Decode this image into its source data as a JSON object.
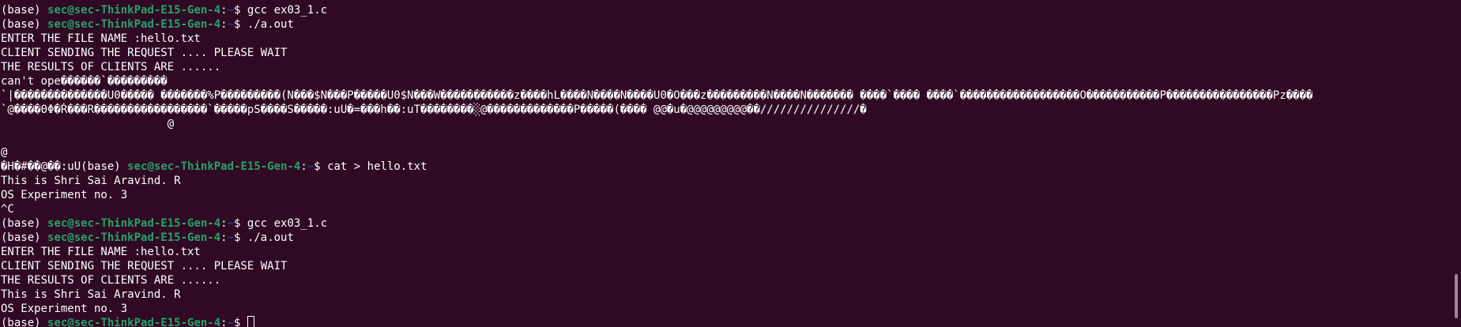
{
  "terminal": {
    "colors": {
      "background": "#300a24",
      "text": "#ffffff",
      "prompt_user": "#26a269",
      "prompt_path": "#12488b"
    },
    "prompt": {
      "env": "(base) ",
      "user_host": "sec@sec-ThinkPad-E15-Gen-4",
      "sep": ":",
      "path": "~",
      "dollar": "$ "
    },
    "lines": [
      {
        "type": "prompt",
        "command": "gcc ex03_1.c"
      },
      {
        "type": "prompt",
        "command": "./a.out"
      },
      {
        "type": "text",
        "text": "ENTER THE FILE NAME :hello.txt"
      },
      {
        "type": "text",
        "text": "CLIENT SENDING THE REQUEST .... PLEASE WAIT"
      },
      {
        "type": "text",
        "text": "THE RESULTS OF CLIENTS ARE ......"
      },
      {
        "type": "text",
        "text": "can't ope������`���������"
      },
      {
        "type": "text",
        "text": "`|��������������U0����� �������%P���������(N���$N���P�����U0$N���W�����������z����hL����N����N����U0�O���z���������N����N������� ����`���� ����`������������������O�����������P����������������Pz����"
      },
      {
        "type": "text",
        "text": "`@����ΘΦ�Ŕ���R�����������������`�����pS����S�����:uU�=���h��:uT��������░@�������������P�����(���� @@�u�@@@@@@@@@��///////////////�"
      },
      {
        "type": "text",
        "text": "                         @"
      },
      {
        "type": "text",
        "text": ""
      },
      {
        "type": "text",
        "text": "@"
      },
      {
        "type": "mixed",
        "prefix": "�H�#��@��:uU",
        "command": "cat > hello.txt"
      },
      {
        "type": "text",
        "text": "This is Shri Sai Aravind. R"
      },
      {
        "type": "text",
        "text": "OS Experiment no. 3"
      },
      {
        "type": "text",
        "text": "^C"
      },
      {
        "type": "prompt",
        "command": "gcc ex03_1.c"
      },
      {
        "type": "prompt",
        "command": "./a.out"
      },
      {
        "type": "text",
        "text": "ENTER THE FILE NAME :hello.txt"
      },
      {
        "type": "text",
        "text": "CLIENT SENDING THE REQUEST .... PLEASE WAIT"
      },
      {
        "type": "text",
        "text": "THE RESULTS OF CLIENTS ARE ......"
      },
      {
        "type": "text",
        "text": "This is Shri Sai Aravind. R"
      },
      {
        "type": "text",
        "text": "OS Experiment no. 3"
      },
      {
        "type": "prompt",
        "command": "",
        "cursor": true
      }
    ]
  }
}
